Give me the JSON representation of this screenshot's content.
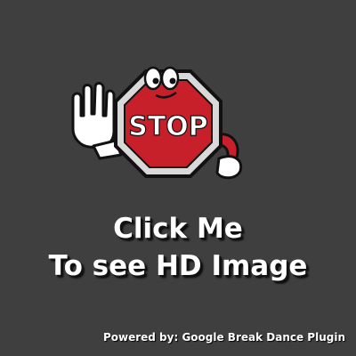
{
  "sign": {
    "text": "STOP"
  },
  "cta": {
    "line1": "Click Me",
    "line2": "To see HD Image"
  },
  "footer": {
    "powered_by": "Powered by: Google Break Dance Plugin"
  },
  "colors": {
    "background": "#3f3f3f",
    "sign_red": "#c8202a",
    "text": "#ffffff"
  }
}
